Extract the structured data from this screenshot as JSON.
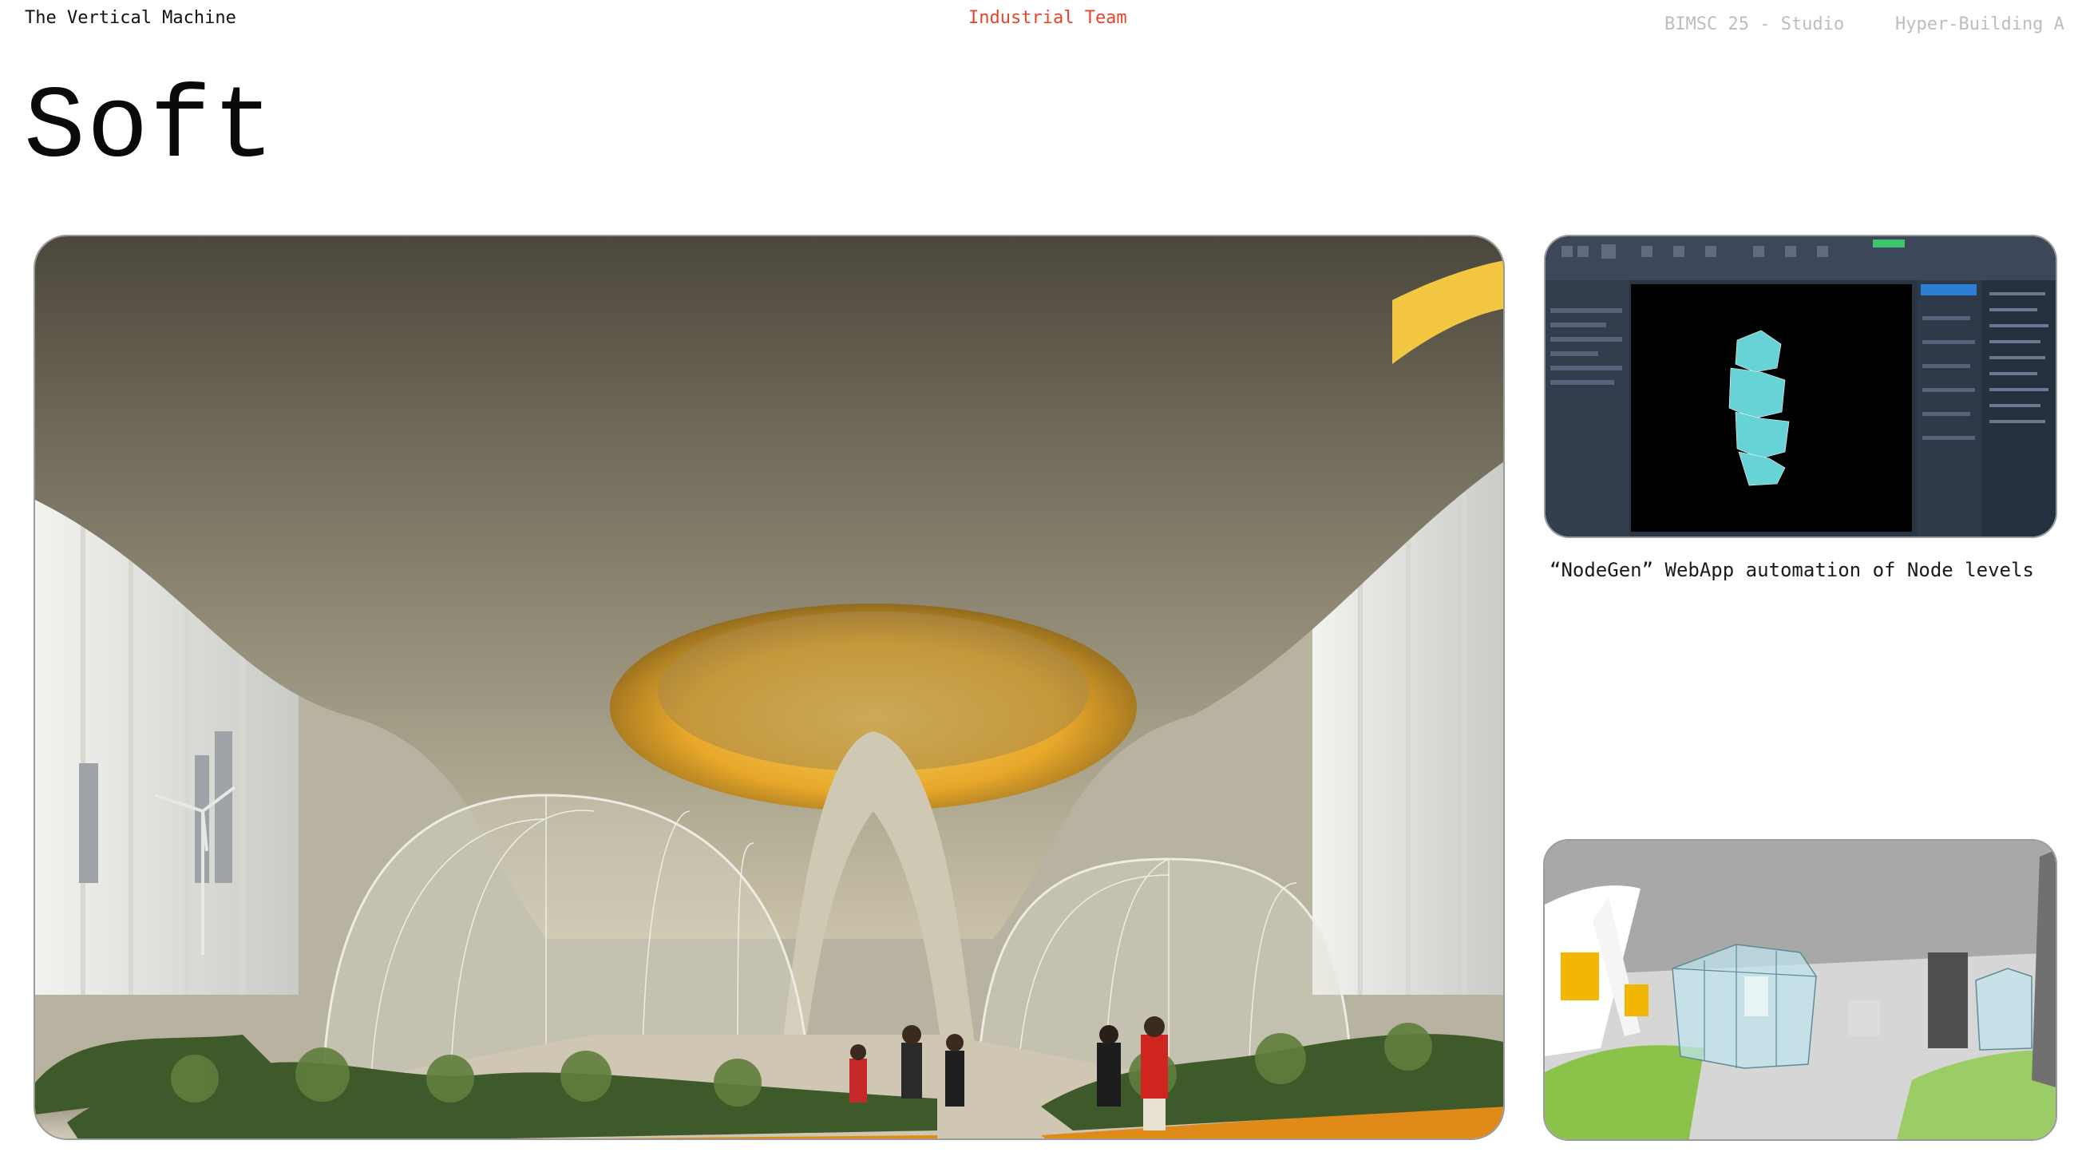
{
  "header": {
    "project": "The Vertical Machine",
    "team": "Industrial Team",
    "course": "BIMSC 25 - Studio",
    "section": "Hyper-Building A"
  },
  "page": {
    "title": "Soft"
  },
  "gallery": {
    "cad_caption": "“NodeGen” WebApp automation of Node levels"
  },
  "colors": {
    "accent": "#e8442a",
    "muted": "#bdbdbd",
    "frame_border": "#9a9a9a"
  }
}
